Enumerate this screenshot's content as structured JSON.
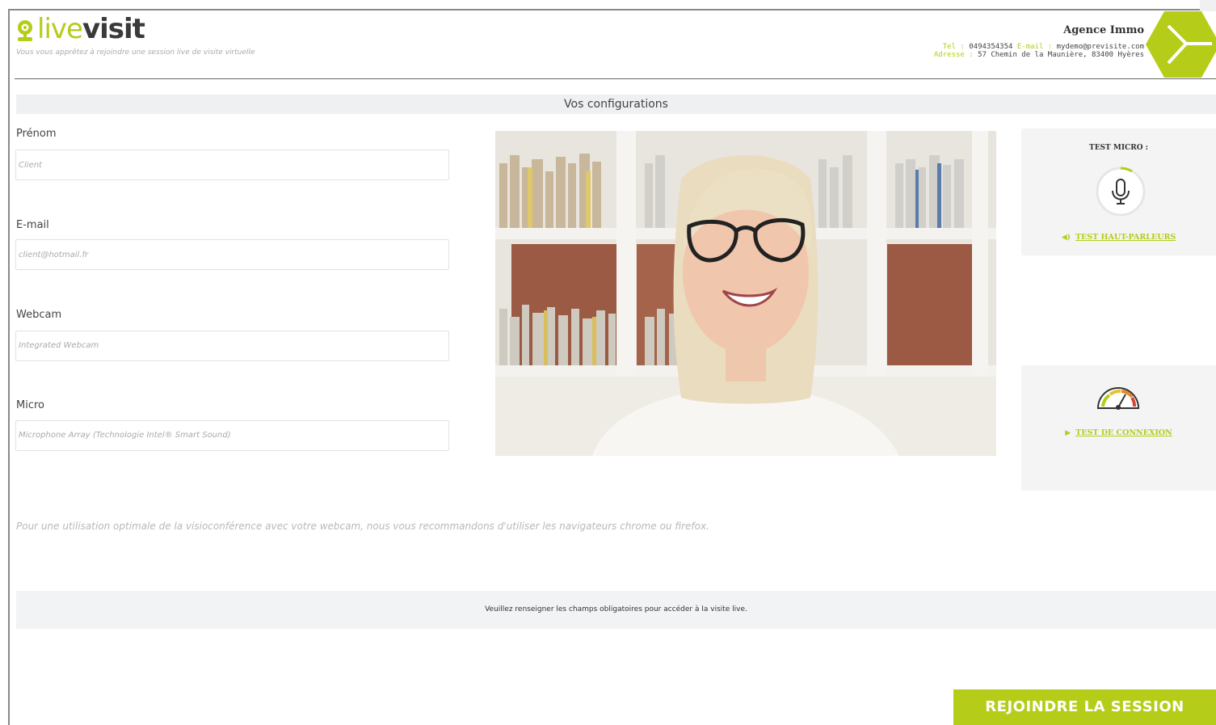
{
  "header": {
    "logo_part1": "live",
    "logo_part2": "visit",
    "tagline": "Vous vous apprêtez à rejoindre une session live de visite virtuelle",
    "agency": {
      "name": "Agence Immo",
      "tel_label": "Tel :",
      "tel": "0494354354",
      "email_label": "E-mail :",
      "email": "mydemo@previsite.com",
      "address_label": "Adresse :",
      "address": "57 Chemin de la Maunière, 83400 Hyères"
    }
  },
  "section_title": "Vos configurations",
  "form": {
    "prenom": {
      "label": "Prénom",
      "placeholder": "Client"
    },
    "email": {
      "label": "E-mail",
      "placeholder": "client@hotmail.fr"
    },
    "webcam": {
      "label": "Webcam",
      "value": "Integrated Webcam"
    },
    "micro": {
      "label": "Micro",
      "value": "Microphone Array (Technologie Intel® Smart Sound)"
    }
  },
  "micro_panel": {
    "title": "TEST MICRO :",
    "speaker_link": "TEST HAUT-PARLEURS"
  },
  "connection_panel": {
    "link": "TEST DE CONNEXION"
  },
  "recommendation": "Pour une utilisation optimale de la visioconférence avec votre webcam, nous vous recommandons d'utiliser les navigateurs chrome ou firefox.",
  "notice": "Veuillez renseigner les champs obligatoires pour accéder à la visite live.",
  "join_button": "REJOINDRE LA SESSION",
  "icons": {
    "logo": "map-pin-icon",
    "brand": "hexagon-logo-icon",
    "mic": "microphone-icon",
    "speaker": "speaker-icon",
    "gauge": "speedometer-icon",
    "play": "play-icon"
  },
  "colors": {
    "accent": "#b5cc18",
    "dark": "#3a3a3a"
  }
}
